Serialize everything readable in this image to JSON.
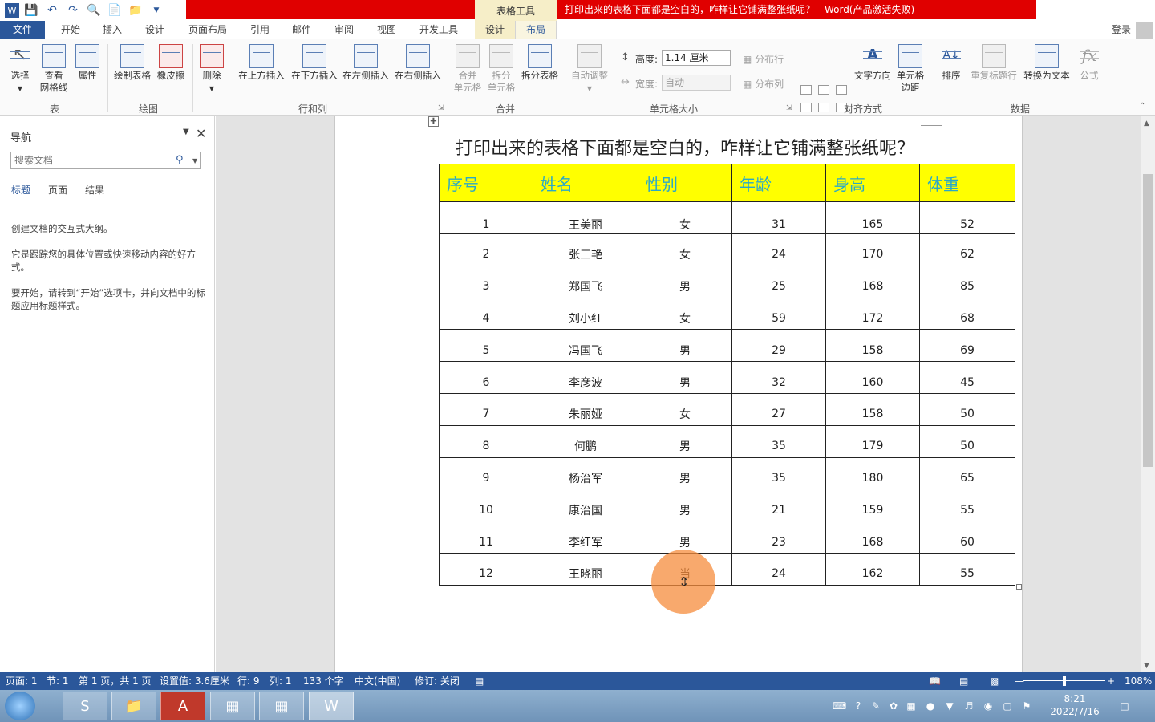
{
  "titlebar": {
    "context_group": "表格工具",
    "document_title": "打印出来的表格下面都是空白的，咋样让它铺满整张纸呢？ - Word(产品激活失败)",
    "help": "?",
    "colors": {
      "title_bar": "#e00000",
      "context": "#f6eec8",
      "brand": "#2b579a"
    }
  },
  "tabs": [
    {
      "label": "文件"
    },
    {
      "label": "开始"
    },
    {
      "label": "插入"
    },
    {
      "label": "设计"
    },
    {
      "label": "页面布局"
    },
    {
      "label": "引用"
    },
    {
      "label": "邮件"
    },
    {
      "label": "审阅"
    },
    {
      "label": "视图"
    },
    {
      "label": "开发工具"
    },
    {
      "label": "设计"
    },
    {
      "label": "布局"
    }
  ],
  "login": "登录",
  "ribbon": {
    "select": "选择",
    "view_gridlines": [
      "查看",
      "网格线"
    ],
    "properties": "属性",
    "draw_table": "绘制表格",
    "eraser": "橡皮擦",
    "delete": "删除",
    "insert_above": "在上方插入",
    "insert_below": "在下方插入",
    "insert_left": "在左侧插入",
    "insert_right": "在右侧插入",
    "merge_cells": [
      "合并",
      "单元格"
    ],
    "split_cells": [
      "拆分",
      "单元格"
    ],
    "split_table": "拆分表格",
    "autofit": "自动调整",
    "height_label": "高度:",
    "height_value": "1.14 厘米",
    "width_label": "宽度:",
    "width_value": "自动",
    "distribute_rows": "分布行",
    "distribute_cols": "分布列",
    "text_direction": "文字方向",
    "cell_margins": [
      "单元格",
      "边距"
    ],
    "sort": "排序",
    "repeat_header": "重复标题行",
    "convert_to_text": "转换为文本",
    "formula": "公式",
    "groups": {
      "table": "表",
      "draw": "绘图",
      "rows_cols": "行和列",
      "merge": "合并",
      "cell_size": "单元格大小",
      "alignment": "对齐方式",
      "data": "数据"
    }
  },
  "nav": {
    "title": "导航",
    "search_placeholder": "搜索文档",
    "tabs": [
      "标题",
      "页面",
      "结果"
    ],
    "text1": "创建文档的交互式大纲。",
    "text2": "它是跟踪您的具体位置或快速移动内容的好方式。",
    "text3": "要开始，请转到“开始”选项卡，并向文档中的标题应用标题样式。"
  },
  "document": {
    "heading": "打印出来的表格下面都是空白的，咋样让它铺满整张纸呢？",
    "table": {
      "headers": [
        "序号",
        "姓名",
        "性别",
        "年龄",
        "身高",
        "体重"
      ],
      "rows": [
        [
          "1",
          "王美丽",
          "女",
          "31",
          "165",
          "52"
        ],
        [
          "2",
          "张三艳",
          "女",
          "24",
          "170",
          "62"
        ],
        [
          "3",
          "郑国飞",
          "男",
          "25",
          "168",
          "85"
        ],
        [
          "4",
          "刘小红",
          "女",
          "59",
          "172",
          "68"
        ],
        [
          "5",
          "冯国飞",
          "男",
          "29",
          "158",
          "69"
        ],
        [
          "6",
          "李彦波",
          "男",
          "32",
          "160",
          "45"
        ],
        [
          "7",
          "朱丽娅",
          "女",
          "27",
          "158",
          "50"
        ],
        [
          "8",
          "何鹏",
          "男",
          "35",
          "179",
          "50"
        ],
        [
          "9",
          "杨治军",
          "男",
          "35",
          "180",
          "65"
        ],
        [
          "10",
          "康治国",
          "男",
          "21",
          "159",
          "55"
        ],
        [
          "11",
          "李红军",
          "男",
          "23",
          "168",
          "60"
        ],
        [
          "12",
          "王晓丽",
          "当",
          "24",
          "162",
          "55"
        ]
      ],
      "header_bg": "#ffff00",
      "header_color": "#2aa8c8"
    }
  },
  "status": {
    "page": "页面: 1",
    "section": "节: 1",
    "page_of": "第 1 页，共 1 页",
    "position": "设置值: 3.6厘米",
    "line": "行: 9",
    "column": "列: 1",
    "words": "133 个字",
    "language": "中文(中国)",
    "track": "修订: 关闭",
    "zoom": "108%"
  },
  "taskbar": {
    "time": "8:21",
    "date": "2022/7/16"
  }
}
